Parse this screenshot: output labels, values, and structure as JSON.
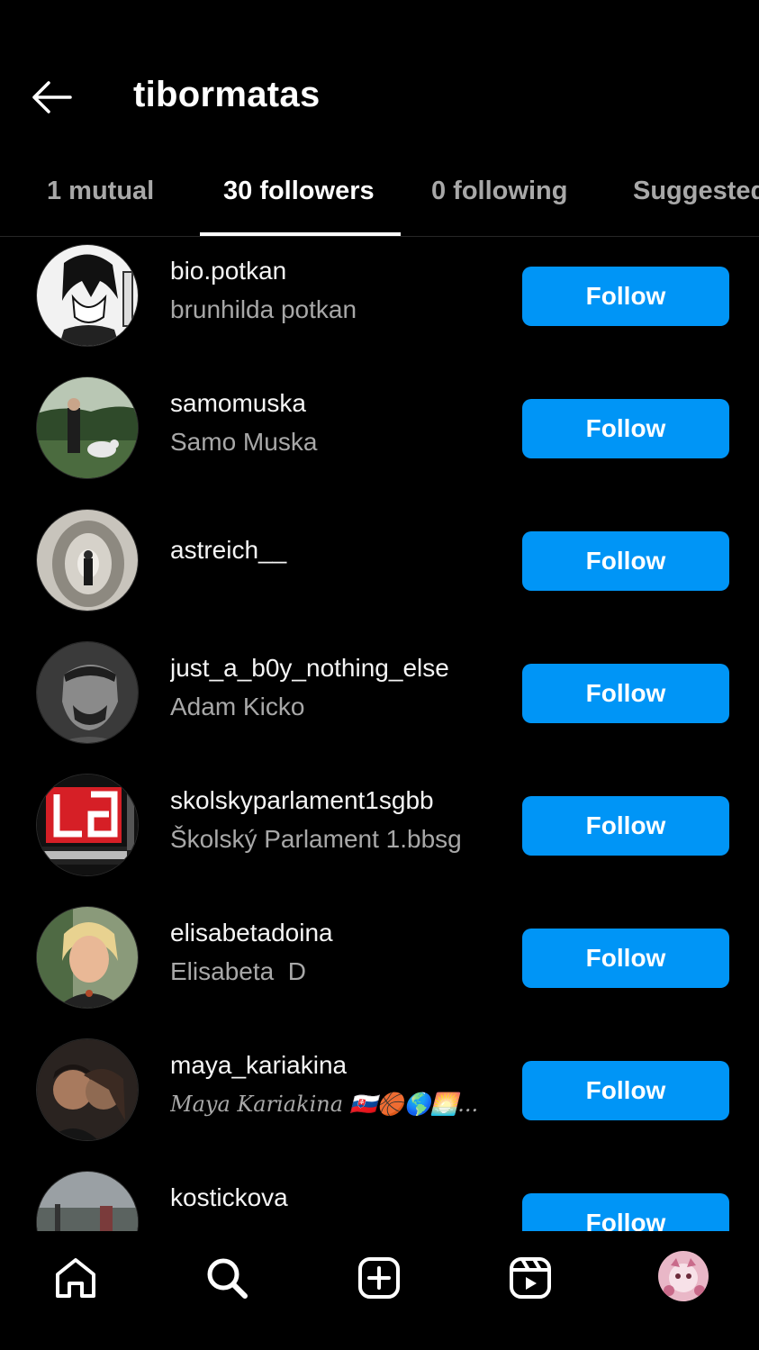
{
  "header": {
    "title": "tibormatas",
    "back_icon": "arrow-left-icon"
  },
  "tabs": [
    {
      "label": "1 mutual",
      "active": false
    },
    {
      "label": "30 followers",
      "active": true
    },
    {
      "label": "0 following",
      "active": false
    },
    {
      "label": "Suggested",
      "active": false
    }
  ],
  "followers": [
    {
      "username": "bio.potkan",
      "full_name": "brunhilda potkan",
      "button": "Follow"
    },
    {
      "username": "samomuska",
      "full_name": "Samo Muska",
      "button": "Follow"
    },
    {
      "username": "astreich__",
      "full_name": "",
      "button": "Follow"
    },
    {
      "username": "just_a_b0y_nothing_else",
      "full_name": "Adam Kicko",
      "button": "Follow"
    },
    {
      "username": "skolskyparlament1sgbb",
      "full_name": "Školský Parlament 1.bbsg",
      "button": "Follow"
    },
    {
      "username": "elisabetadoina",
      "full_name": "Elisabeta  D",
      "button": "Follow"
    },
    {
      "username": "maya_kariakina",
      "full_name": "Maya Kariakina 🇸🇰🏀🌎🌅...",
      "button": "Follow"
    },
    {
      "username": "kostickova",
      "full_name": "",
      "button": "Follow"
    }
  ],
  "bottom_nav": {
    "items": [
      "home-icon",
      "search-icon",
      "new-post-icon",
      "reels-icon",
      "profile-avatar"
    ]
  },
  "colors": {
    "background": "#000000",
    "follow_button": "#0095f6",
    "secondary_text": "#a8a8a8",
    "divider": "#262626"
  }
}
